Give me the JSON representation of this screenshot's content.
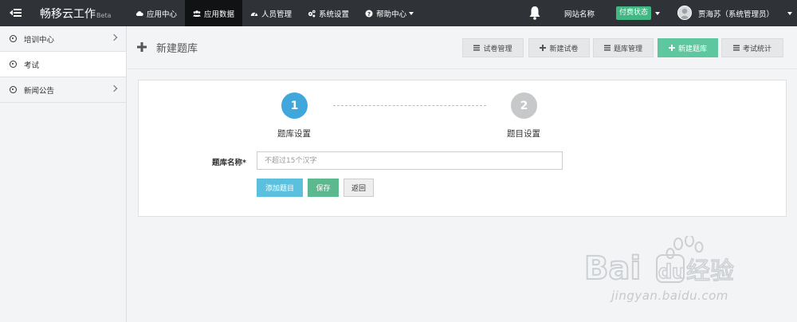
{
  "topbar": {
    "brand": "畅移云工作",
    "brand_suffix": "Beta",
    "nav": [
      {
        "label": "应用中心",
        "icon": "cloud-icon",
        "active": false
      },
      {
        "label": "应用数据",
        "icon": "users-icon",
        "active": true
      },
      {
        "label": "人员管理",
        "icon": "gauge-icon",
        "active": false
      },
      {
        "label": "系统设置",
        "icon": "cogs-icon",
        "active": false
      },
      {
        "label": "帮助中心",
        "icon": "question-icon",
        "active": false,
        "dropdown": true
      }
    ],
    "site_name": "网站名称",
    "pay_status": "付费状态",
    "user": "贾海苏（系统管理员）"
  },
  "sidebar": {
    "items": [
      {
        "label": "培训中心",
        "has_children": true,
        "active": false
      },
      {
        "label": "考试",
        "has_children": false,
        "active": true
      },
      {
        "label": "新闻公告",
        "has_children": true,
        "active": false
      }
    ]
  },
  "page": {
    "title": "新建题库",
    "toolbar": [
      {
        "label": "试卷管理",
        "icon": "list-icon",
        "style": "default"
      },
      {
        "label": "新建试卷",
        "icon": "plus-icon",
        "style": "default"
      },
      {
        "label": "题库管理",
        "icon": "list-icon",
        "style": "default"
      },
      {
        "label": "新建题库",
        "icon": "plus-icon",
        "style": "green"
      },
      {
        "label": "考试统计",
        "icon": "list-icon",
        "style": "default"
      }
    ]
  },
  "steps": [
    {
      "number": "1",
      "label": "题库设置",
      "active": true
    },
    {
      "number": "2",
      "label": "题目设置",
      "active": false
    }
  ],
  "form": {
    "name_label": "题库名称*",
    "name_placeholder": "不超过15个汉字",
    "name_value": "",
    "add_button": "添加题目",
    "save_button": "保存",
    "back_button": "返回"
  },
  "watermark": {
    "url": "jingyan.baidu.com"
  },
  "colors": {
    "topbar_bg": "#2f3338",
    "active_nav_bg": "#111214",
    "step_active": "#3fa7dc",
    "step_inactive": "#c7c8ca",
    "btn_blue": "#5bc0de",
    "btn_green": "#5cb88f",
    "toolbar_green": "#5fc7a0",
    "pay_badge": "#41b883"
  }
}
